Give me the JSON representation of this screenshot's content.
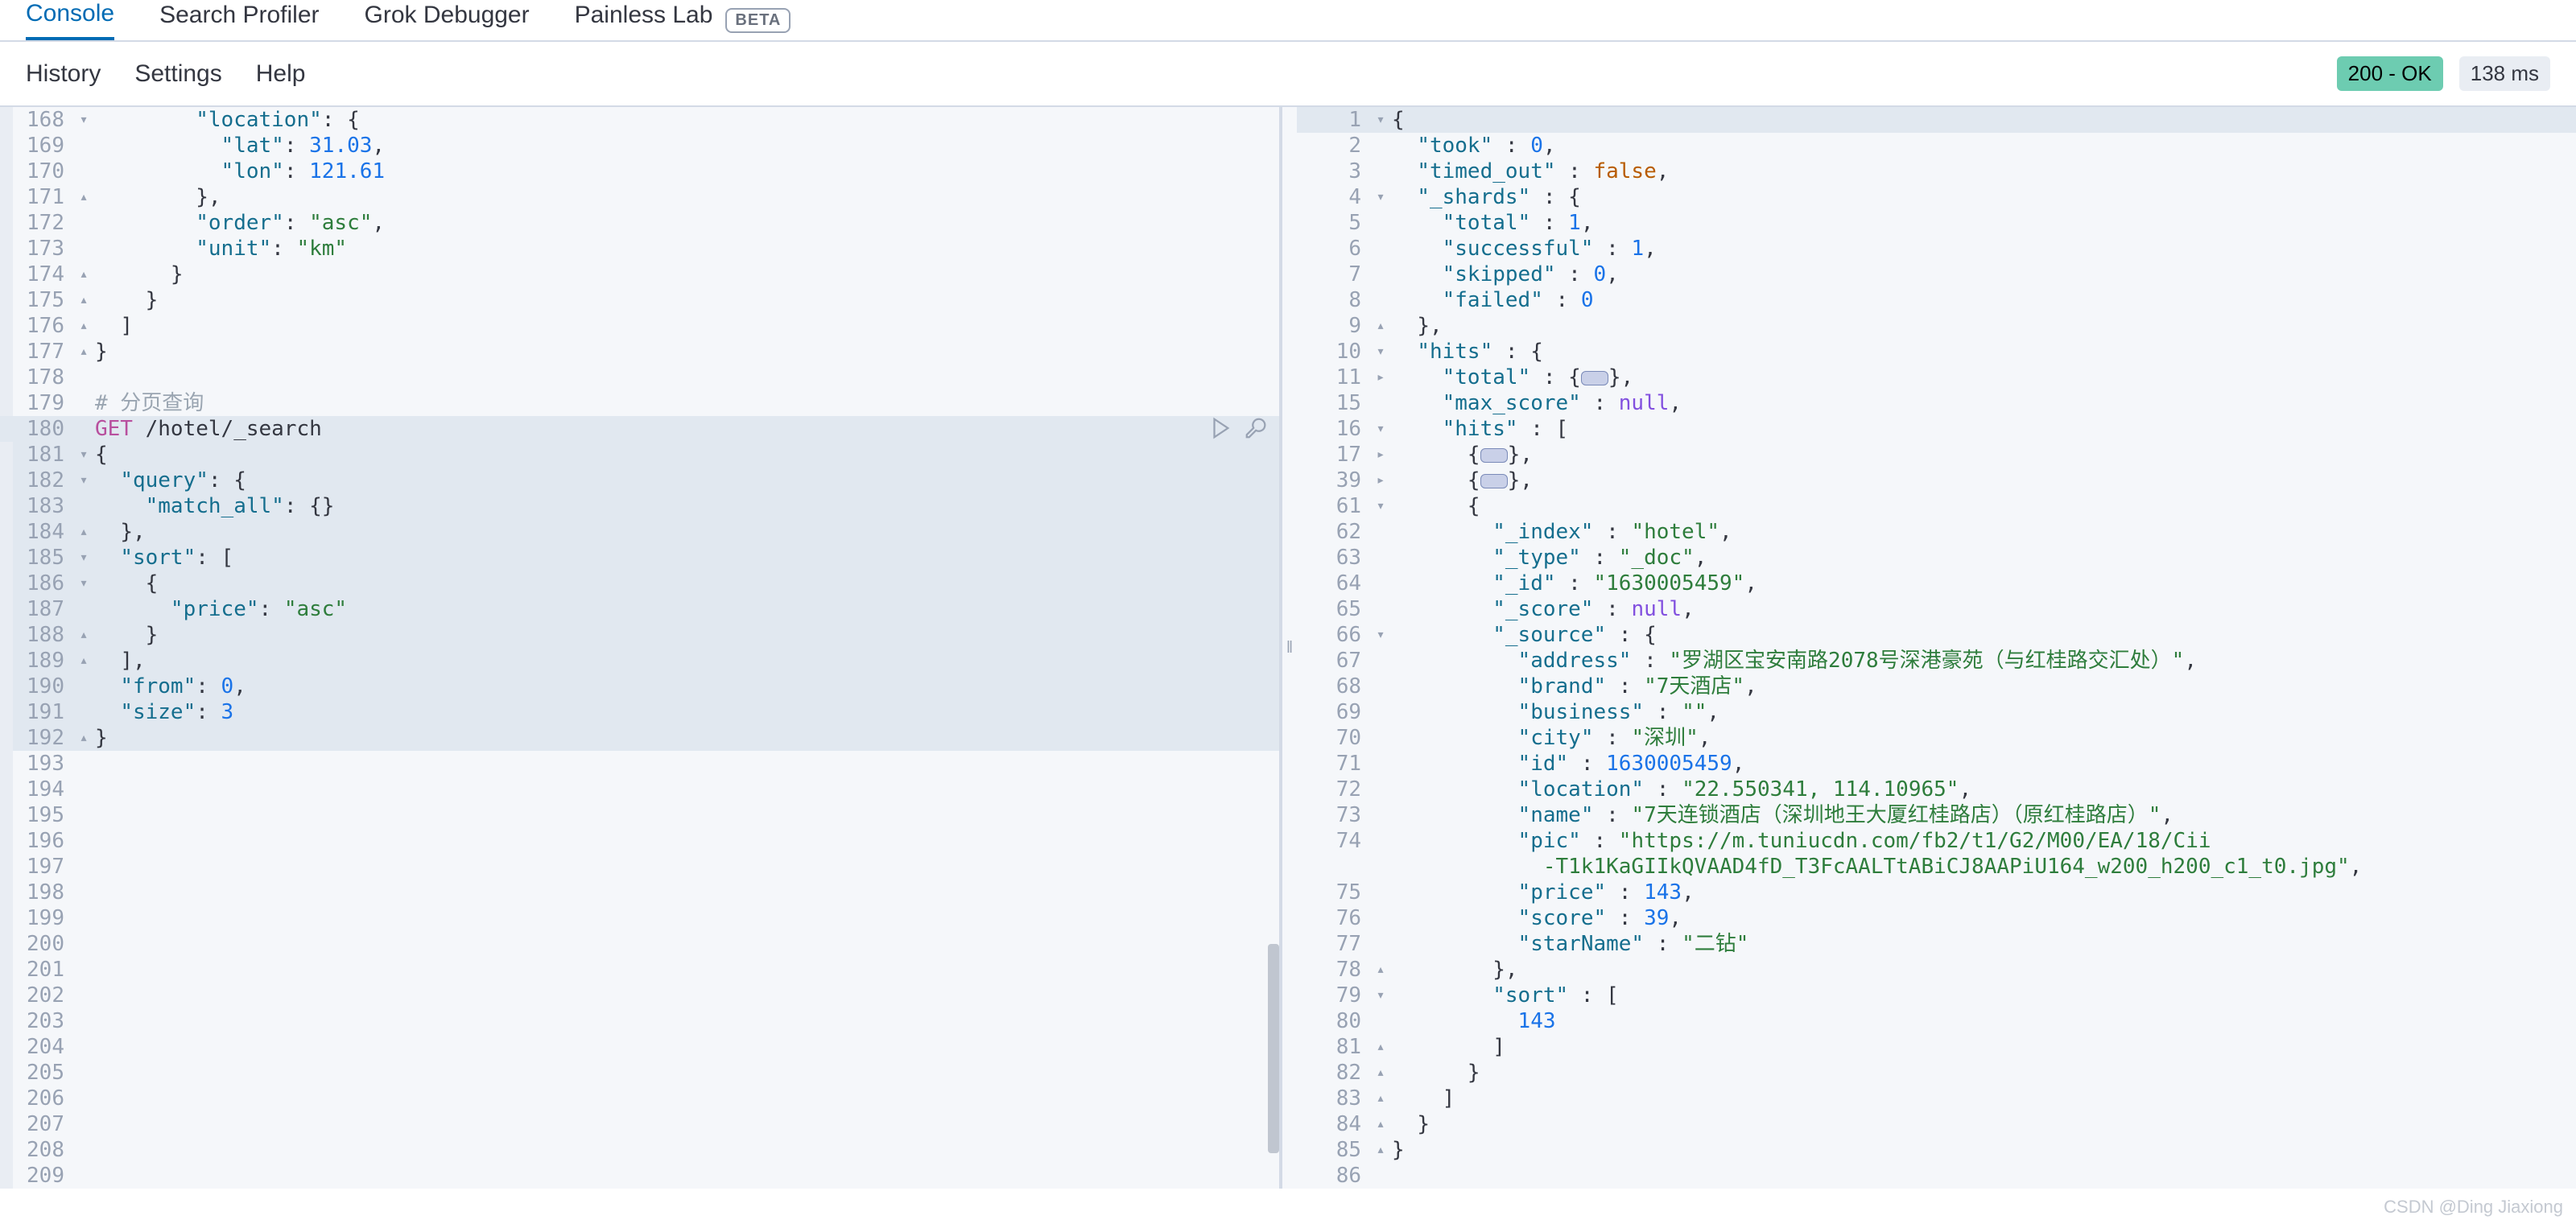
{
  "top_tabs": {
    "console": "Console",
    "search_profiler": "Search Profiler",
    "grok_debugger": "Grok Debugger",
    "painless_lab": "Painless Lab",
    "beta": "BETA"
  },
  "sub_bar": {
    "history": "History",
    "settings": "Settings",
    "help": "Help",
    "status": "200 - OK",
    "time": "138 ms"
  },
  "request": {
    "lines": [
      {
        "n": 168,
        "f": "▾",
        "i": 4,
        "t": [
          [
            "key",
            "\"location\""
          ],
          [
            "punc",
            ": {"
          ]
        ]
      },
      {
        "n": 169,
        "f": "",
        "i": 5,
        "t": [
          [
            "key",
            "\"lat\""
          ],
          [
            "punc",
            ": "
          ],
          [
            "num",
            "31.03"
          ],
          [
            "punc",
            ","
          ]
        ]
      },
      {
        "n": 170,
        "f": "",
        "i": 5,
        "t": [
          [
            "key",
            "\"lon\""
          ],
          [
            "punc",
            ": "
          ],
          [
            "num",
            "121.61"
          ]
        ]
      },
      {
        "n": 171,
        "f": "▴",
        "i": 4,
        "t": [
          [
            "punc",
            "},"
          ]
        ]
      },
      {
        "n": 172,
        "f": "",
        "i": 4,
        "t": [
          [
            "key",
            "\"order\""
          ],
          [
            "punc",
            ": "
          ],
          [
            "str",
            "\"asc\""
          ],
          [
            "punc",
            ","
          ]
        ]
      },
      {
        "n": 173,
        "f": "",
        "i": 4,
        "t": [
          [
            "key",
            "\"unit\""
          ],
          [
            "punc",
            ": "
          ],
          [
            "str",
            "\"km\""
          ]
        ]
      },
      {
        "n": 174,
        "f": "▴",
        "i": 3,
        "t": [
          [
            "punc",
            "}"
          ]
        ]
      },
      {
        "n": 175,
        "f": "▴",
        "i": 2,
        "t": [
          [
            "punc",
            "}"
          ]
        ]
      },
      {
        "n": 176,
        "f": "▴",
        "i": 1,
        "t": [
          [
            "punc",
            "]"
          ]
        ]
      },
      {
        "n": 177,
        "f": "▴",
        "i": 0,
        "t": [
          [
            "punc",
            "}"
          ]
        ]
      },
      {
        "n": 178,
        "f": "",
        "i": 0,
        "t": []
      },
      {
        "n": 179,
        "f": "",
        "i": 0,
        "t": [
          [
            "comment",
            "# 分页查询"
          ]
        ]
      },
      {
        "n": 180,
        "f": "",
        "i": 0,
        "hl": true,
        "run": true,
        "t": [
          [
            "method",
            "GET"
          ],
          [
            "punc",
            " /hotel/_search"
          ]
        ]
      },
      {
        "n": 181,
        "f": "▾",
        "i": 0,
        "hl": true,
        "t": [
          [
            "punc",
            "{"
          ]
        ]
      },
      {
        "n": 182,
        "f": "▾",
        "i": 1,
        "hl": true,
        "t": [
          [
            "key",
            "\"query\""
          ],
          [
            "punc",
            ": {"
          ]
        ]
      },
      {
        "n": 183,
        "f": "",
        "i": 2,
        "hl": true,
        "t": [
          [
            "key",
            "\"match_all\""
          ],
          [
            "punc",
            ": {}"
          ]
        ]
      },
      {
        "n": 184,
        "f": "▴",
        "i": 1,
        "hl": true,
        "t": [
          [
            "punc",
            "},"
          ]
        ]
      },
      {
        "n": 185,
        "f": "▾",
        "i": 1,
        "hl": true,
        "t": [
          [
            "key",
            "\"sort\""
          ],
          [
            "punc",
            ": ["
          ]
        ]
      },
      {
        "n": 186,
        "f": "▾",
        "i": 2,
        "hl": true,
        "t": [
          [
            "punc",
            "{"
          ]
        ]
      },
      {
        "n": 187,
        "f": "",
        "i": 3,
        "hl": true,
        "t": [
          [
            "key",
            "\"price\""
          ],
          [
            "punc",
            ": "
          ],
          [
            "str",
            "\"asc\""
          ]
        ]
      },
      {
        "n": 188,
        "f": "▴",
        "i": 2,
        "hl": true,
        "t": [
          [
            "punc",
            "}"
          ]
        ]
      },
      {
        "n": 189,
        "f": "▴",
        "i": 1,
        "hl": true,
        "t": [
          [
            "punc",
            "],"
          ]
        ]
      },
      {
        "n": 190,
        "f": "",
        "i": 1,
        "hl": true,
        "t": [
          [
            "key",
            "\"from\""
          ],
          [
            "punc",
            ": "
          ],
          [
            "num",
            "0"
          ],
          [
            "punc",
            ","
          ]
        ]
      },
      {
        "n": 191,
        "f": "",
        "i": 1,
        "hl": true,
        "t": [
          [
            "key",
            "\"size\""
          ],
          [
            "punc",
            ": "
          ],
          [
            "num",
            "3"
          ]
        ]
      },
      {
        "n": 192,
        "f": "▴",
        "i": 0,
        "hl": true,
        "t": [
          [
            "punc",
            "}"
          ]
        ]
      },
      {
        "n": 193,
        "f": "",
        "i": 0,
        "t": []
      },
      {
        "n": 194,
        "f": "",
        "i": 0,
        "t": []
      },
      {
        "n": 195,
        "f": "",
        "i": 0,
        "t": []
      },
      {
        "n": 196,
        "f": "",
        "i": 0,
        "t": []
      },
      {
        "n": 197,
        "f": "",
        "i": 0,
        "t": []
      },
      {
        "n": 198,
        "f": "",
        "i": 0,
        "t": []
      },
      {
        "n": 199,
        "f": "",
        "i": 0,
        "t": []
      },
      {
        "n": 200,
        "f": "",
        "i": 0,
        "t": []
      },
      {
        "n": 201,
        "f": "",
        "i": 0,
        "t": []
      },
      {
        "n": 202,
        "f": "",
        "i": 0,
        "t": []
      },
      {
        "n": 203,
        "f": "",
        "i": 0,
        "t": []
      },
      {
        "n": 204,
        "f": "",
        "i": 0,
        "t": []
      },
      {
        "n": 205,
        "f": "",
        "i": 0,
        "t": []
      },
      {
        "n": 206,
        "f": "",
        "i": 0,
        "t": []
      },
      {
        "n": 207,
        "f": "",
        "i": 0,
        "t": []
      },
      {
        "n": 208,
        "f": "",
        "i": 0,
        "t": []
      },
      {
        "n": 209,
        "f": "",
        "i": 0,
        "t": []
      }
    ]
  },
  "response": {
    "lines": [
      {
        "n": 1,
        "f": "▾",
        "i": 0,
        "hl": true,
        "t": [
          [
            "punc",
            "{"
          ]
        ]
      },
      {
        "n": 2,
        "f": "",
        "i": 1,
        "t": [
          [
            "key",
            "\"took\""
          ],
          [
            "punc",
            " : "
          ],
          [
            "num",
            "0"
          ],
          [
            "punc",
            ","
          ]
        ]
      },
      {
        "n": 3,
        "f": "",
        "i": 1,
        "t": [
          [
            "key",
            "\"timed_out\""
          ],
          [
            "punc",
            " : "
          ],
          [
            "bool",
            "false"
          ],
          [
            "punc",
            ","
          ]
        ]
      },
      {
        "n": 4,
        "f": "▾",
        "i": 1,
        "t": [
          [
            "key",
            "\"_shards\""
          ],
          [
            "punc",
            " : {"
          ]
        ]
      },
      {
        "n": 5,
        "f": "",
        "i": 2,
        "t": [
          [
            "key",
            "\"total\""
          ],
          [
            "punc",
            " : "
          ],
          [
            "num",
            "1"
          ],
          [
            "punc",
            ","
          ]
        ]
      },
      {
        "n": 6,
        "f": "",
        "i": 2,
        "t": [
          [
            "key",
            "\"successful\""
          ],
          [
            "punc",
            " : "
          ],
          [
            "num",
            "1"
          ],
          [
            "punc",
            ","
          ]
        ]
      },
      {
        "n": 7,
        "f": "",
        "i": 2,
        "t": [
          [
            "key",
            "\"skipped\""
          ],
          [
            "punc",
            " : "
          ],
          [
            "num",
            "0"
          ],
          [
            "punc",
            ","
          ]
        ]
      },
      {
        "n": 8,
        "f": "",
        "i": 2,
        "t": [
          [
            "key",
            "\"failed\""
          ],
          [
            "punc",
            " : "
          ],
          [
            "num",
            "0"
          ]
        ]
      },
      {
        "n": 9,
        "f": "▴",
        "i": 1,
        "t": [
          [
            "punc",
            "},"
          ]
        ]
      },
      {
        "n": 10,
        "f": "▾",
        "i": 1,
        "t": [
          [
            "key",
            "\"hits\""
          ],
          [
            "punc",
            " : {"
          ]
        ]
      },
      {
        "n": 11,
        "f": "▸",
        "i": 2,
        "t": [
          [
            "key",
            "\"total\""
          ],
          [
            "punc",
            " : {"
          ],
          [
            "badge",
            ""
          ],
          [
            "punc",
            "},"
          ]
        ]
      },
      {
        "n": 15,
        "f": "",
        "i": 2,
        "t": [
          [
            "key",
            "\"max_score\""
          ],
          [
            "punc",
            " : "
          ],
          [
            "null",
            "null"
          ],
          [
            "punc",
            ","
          ]
        ]
      },
      {
        "n": 16,
        "f": "▾",
        "i": 2,
        "t": [
          [
            "key",
            "\"hits\""
          ],
          [
            "punc",
            " : ["
          ]
        ]
      },
      {
        "n": 17,
        "f": "▸",
        "i": 3,
        "t": [
          [
            "punc",
            "{"
          ],
          [
            "badge",
            ""
          ],
          [
            "punc",
            "},"
          ]
        ]
      },
      {
        "n": 39,
        "f": "▸",
        "i": 3,
        "t": [
          [
            "punc",
            "{"
          ],
          [
            "badge",
            ""
          ],
          [
            "punc",
            "},"
          ]
        ]
      },
      {
        "n": 61,
        "f": "▾",
        "i": 3,
        "t": [
          [
            "punc",
            "{"
          ]
        ]
      },
      {
        "n": 62,
        "f": "",
        "i": 4,
        "t": [
          [
            "key",
            "\"_index\""
          ],
          [
            "punc",
            " : "
          ],
          [
            "str",
            "\"hotel\""
          ],
          [
            "punc",
            ","
          ]
        ]
      },
      {
        "n": 63,
        "f": "",
        "i": 4,
        "t": [
          [
            "key",
            "\"_type\""
          ],
          [
            "punc",
            " : "
          ],
          [
            "str",
            "\"_doc\""
          ],
          [
            "punc",
            ","
          ]
        ]
      },
      {
        "n": 64,
        "f": "",
        "i": 4,
        "t": [
          [
            "key",
            "\"_id\""
          ],
          [
            "punc",
            " : "
          ],
          [
            "str",
            "\"1630005459\""
          ],
          [
            "punc",
            ","
          ]
        ]
      },
      {
        "n": 65,
        "f": "",
        "i": 4,
        "t": [
          [
            "key",
            "\"_score\""
          ],
          [
            "punc",
            " : "
          ],
          [
            "null",
            "null"
          ],
          [
            "punc",
            ","
          ]
        ]
      },
      {
        "n": 66,
        "f": "▾",
        "i": 4,
        "t": [
          [
            "key",
            "\"_source\""
          ],
          [
            "punc",
            " : {"
          ]
        ]
      },
      {
        "n": 67,
        "f": "",
        "i": 5,
        "t": [
          [
            "key",
            "\"address\""
          ],
          [
            "punc",
            " : "
          ],
          [
            "str",
            "\"罗湖区宝安南路2078号深港豪苑（与红桂路交汇处）\""
          ],
          [
            "punc",
            ","
          ]
        ]
      },
      {
        "n": 68,
        "f": "",
        "i": 5,
        "t": [
          [
            "key",
            "\"brand\""
          ],
          [
            "punc",
            " : "
          ],
          [
            "str",
            "\"7天酒店\""
          ],
          [
            "punc",
            ","
          ]
        ]
      },
      {
        "n": 69,
        "f": "",
        "i": 5,
        "t": [
          [
            "key",
            "\"business\""
          ],
          [
            "punc",
            " : "
          ],
          [
            "str",
            "\"\""
          ],
          [
            "punc",
            ","
          ]
        ]
      },
      {
        "n": 70,
        "f": "",
        "i": 5,
        "t": [
          [
            "key",
            "\"city\""
          ],
          [
            "punc",
            " : "
          ],
          [
            "str",
            "\"深圳\""
          ],
          [
            "punc",
            ","
          ]
        ]
      },
      {
        "n": 71,
        "f": "",
        "i": 5,
        "t": [
          [
            "key",
            "\"id\""
          ],
          [
            "punc",
            " : "
          ],
          [
            "num",
            "1630005459"
          ],
          [
            "punc",
            ","
          ]
        ]
      },
      {
        "n": 72,
        "f": "",
        "i": 5,
        "t": [
          [
            "key",
            "\"location\""
          ],
          [
            "punc",
            " : "
          ],
          [
            "str",
            "\"22.550341, 114.10965\""
          ],
          [
            "punc",
            ","
          ]
        ]
      },
      {
        "n": 73,
        "f": "",
        "i": 5,
        "t": [
          [
            "key",
            "\"name\""
          ],
          [
            "punc",
            " : "
          ],
          [
            "str",
            "\"7天连锁酒店（深圳地王大厦红桂路店）（原红桂路店）\""
          ],
          [
            "punc",
            ","
          ]
        ]
      },
      {
        "n": 74,
        "f": "",
        "i": 5,
        "t": [
          [
            "key",
            "\"pic\""
          ],
          [
            "punc",
            " : "
          ],
          [
            "str",
            "\"https://m.tuniucdn.com/fb2/t1/G2/M00/EA/18/Cii"
          ]
        ]
      },
      {
        "n": "",
        "f": "",
        "i": 6,
        "t": [
          [
            "str",
            "-T1k1KaGIIkQVAAD4fD_T3FcAALTtABiCJ8AAPiU164_w200_h200_c1_t0.jpg\""
          ],
          [
            "punc",
            ","
          ]
        ]
      },
      {
        "n": 75,
        "f": "",
        "i": 5,
        "t": [
          [
            "key",
            "\"price\""
          ],
          [
            "punc",
            " : "
          ],
          [
            "num",
            "143"
          ],
          [
            "punc",
            ","
          ]
        ]
      },
      {
        "n": 76,
        "f": "",
        "i": 5,
        "t": [
          [
            "key",
            "\"score\""
          ],
          [
            "punc",
            " : "
          ],
          [
            "num",
            "39"
          ],
          [
            "punc",
            ","
          ]
        ]
      },
      {
        "n": 77,
        "f": "",
        "i": 5,
        "t": [
          [
            "key",
            "\"starName\""
          ],
          [
            "punc",
            " : "
          ],
          [
            "str",
            "\"二钻\""
          ]
        ]
      },
      {
        "n": 78,
        "f": "▴",
        "i": 4,
        "t": [
          [
            "punc",
            "},"
          ]
        ]
      },
      {
        "n": 79,
        "f": "▾",
        "i": 4,
        "t": [
          [
            "key",
            "\"sort\""
          ],
          [
            "punc",
            " : ["
          ]
        ]
      },
      {
        "n": 80,
        "f": "",
        "i": 5,
        "t": [
          [
            "num",
            "143"
          ]
        ]
      },
      {
        "n": 81,
        "f": "▴",
        "i": 4,
        "t": [
          [
            "punc",
            "]"
          ]
        ]
      },
      {
        "n": 82,
        "f": "▴",
        "i": 3,
        "t": [
          [
            "punc",
            "}"
          ]
        ]
      },
      {
        "n": 83,
        "f": "▴",
        "i": 2,
        "t": [
          [
            "punc",
            "]"
          ]
        ]
      },
      {
        "n": 84,
        "f": "▴",
        "i": 1,
        "t": [
          [
            "punc",
            "}"
          ]
        ]
      },
      {
        "n": 85,
        "f": "▴",
        "i": 0,
        "t": [
          [
            "punc",
            "}"
          ]
        ]
      },
      {
        "n": 86,
        "f": "",
        "i": 0,
        "t": []
      }
    ]
  },
  "watermark": "CSDN @Ding Jiaxiong"
}
